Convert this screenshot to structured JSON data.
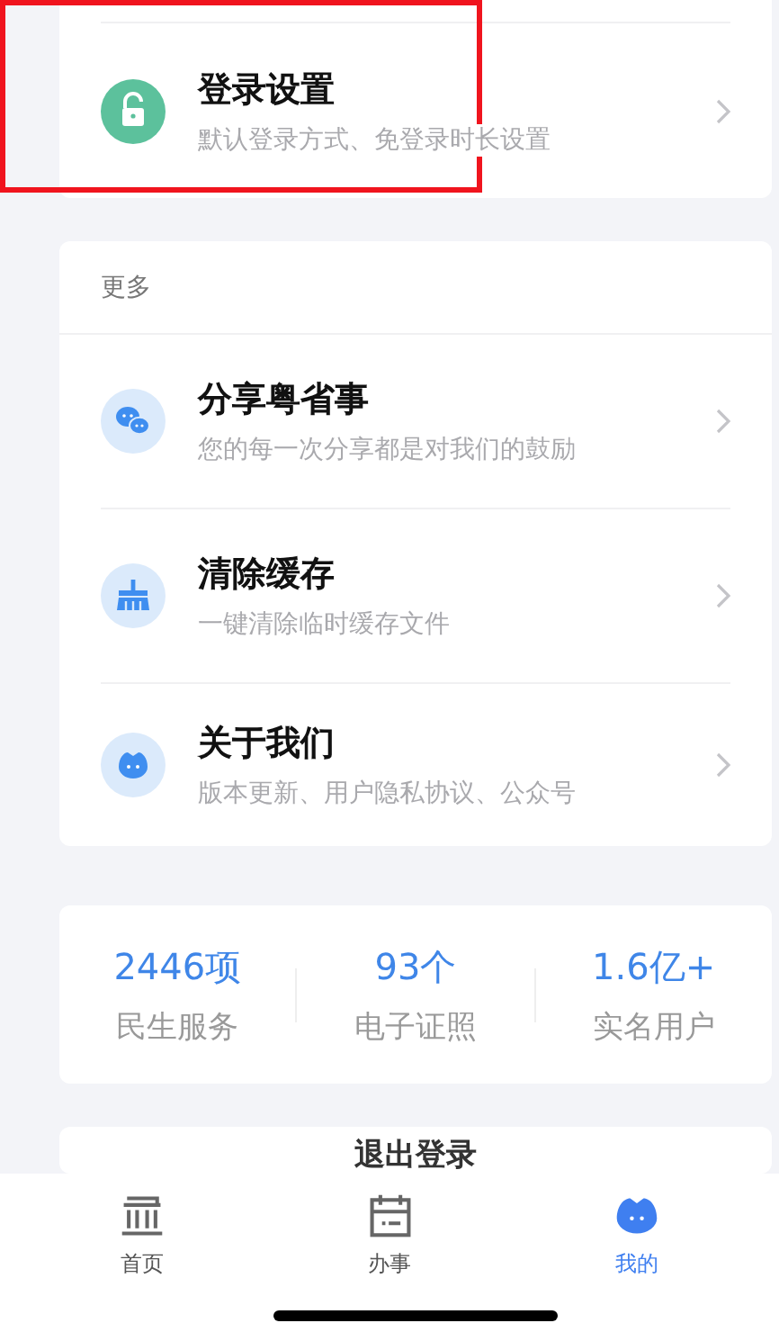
{
  "top_items": [
    {
      "kind": "lock",
      "title": "登录设置",
      "subtitle": "默认登录方式、免登录时长设置",
      "highlighted": true
    }
  ],
  "more_section": {
    "header": "更多",
    "items": [
      {
        "kind": "chat",
        "title": "分享粤省事",
        "subtitle": "您的每一次分享都是对我们的鼓励",
        "highlighted": false
      },
      {
        "kind": "broom",
        "title": "清除缓存",
        "subtitle": "一键清除临时缓存文件",
        "highlighted": false
      },
      {
        "kind": "mascot",
        "title": "关于我们",
        "subtitle": "版本更新、用户隐私协议、公众号",
        "highlighted": false
      }
    ]
  },
  "stats": [
    {
      "value": "2446项",
      "label": "民生服务"
    },
    {
      "value": "93个",
      "label": "电子证照"
    },
    {
      "value": "1.6亿+",
      "label": "实名用户"
    }
  ],
  "logout_button": "退出登录",
  "tabs": [
    {
      "kind": "building",
      "label": "首页",
      "selected": false
    },
    {
      "kind": "calendar",
      "label": "办事",
      "selected": false
    },
    {
      "kind": "mascot",
      "label": "我的",
      "selected": true
    }
  ]
}
